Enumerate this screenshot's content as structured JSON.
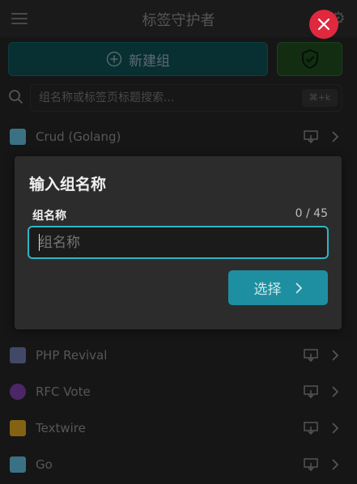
{
  "app": {
    "title": "标签守护者"
  },
  "toolbar": {
    "new_group_label": "新建组"
  },
  "search": {
    "placeholder": "组名称或标签页标题搜索...",
    "shortcut": "⌘+k"
  },
  "groups": [
    {
      "label": "Crud (Golang)",
      "icon": "gopher-icon",
      "color": "#5fb7d6"
    },
    {
      "label": "PHP Revival",
      "icon": "php-icon",
      "color": "#6a74a8"
    },
    {
      "label": "RFC Vote",
      "icon": "rfc-icon",
      "color": "#7b3fa6"
    },
    {
      "label": "Textwire",
      "icon": "textwire-icon",
      "color": "#d4a020"
    },
    {
      "label": "Go",
      "icon": "gopher-icon",
      "color": "#5fb7d6"
    }
  ],
  "dialog": {
    "title": "输入组名称",
    "field_label": "组名称",
    "counter": "0 / 45",
    "input_placeholder": "组名称",
    "input_value": "",
    "submit_label": "选择"
  },
  "colors": {
    "accent": "#2db5c6",
    "submit_button": "#1e8fa0",
    "close_button": "#e0283f",
    "new_group_button": "#0e4c52",
    "shield_button": "#1d4a1d"
  }
}
